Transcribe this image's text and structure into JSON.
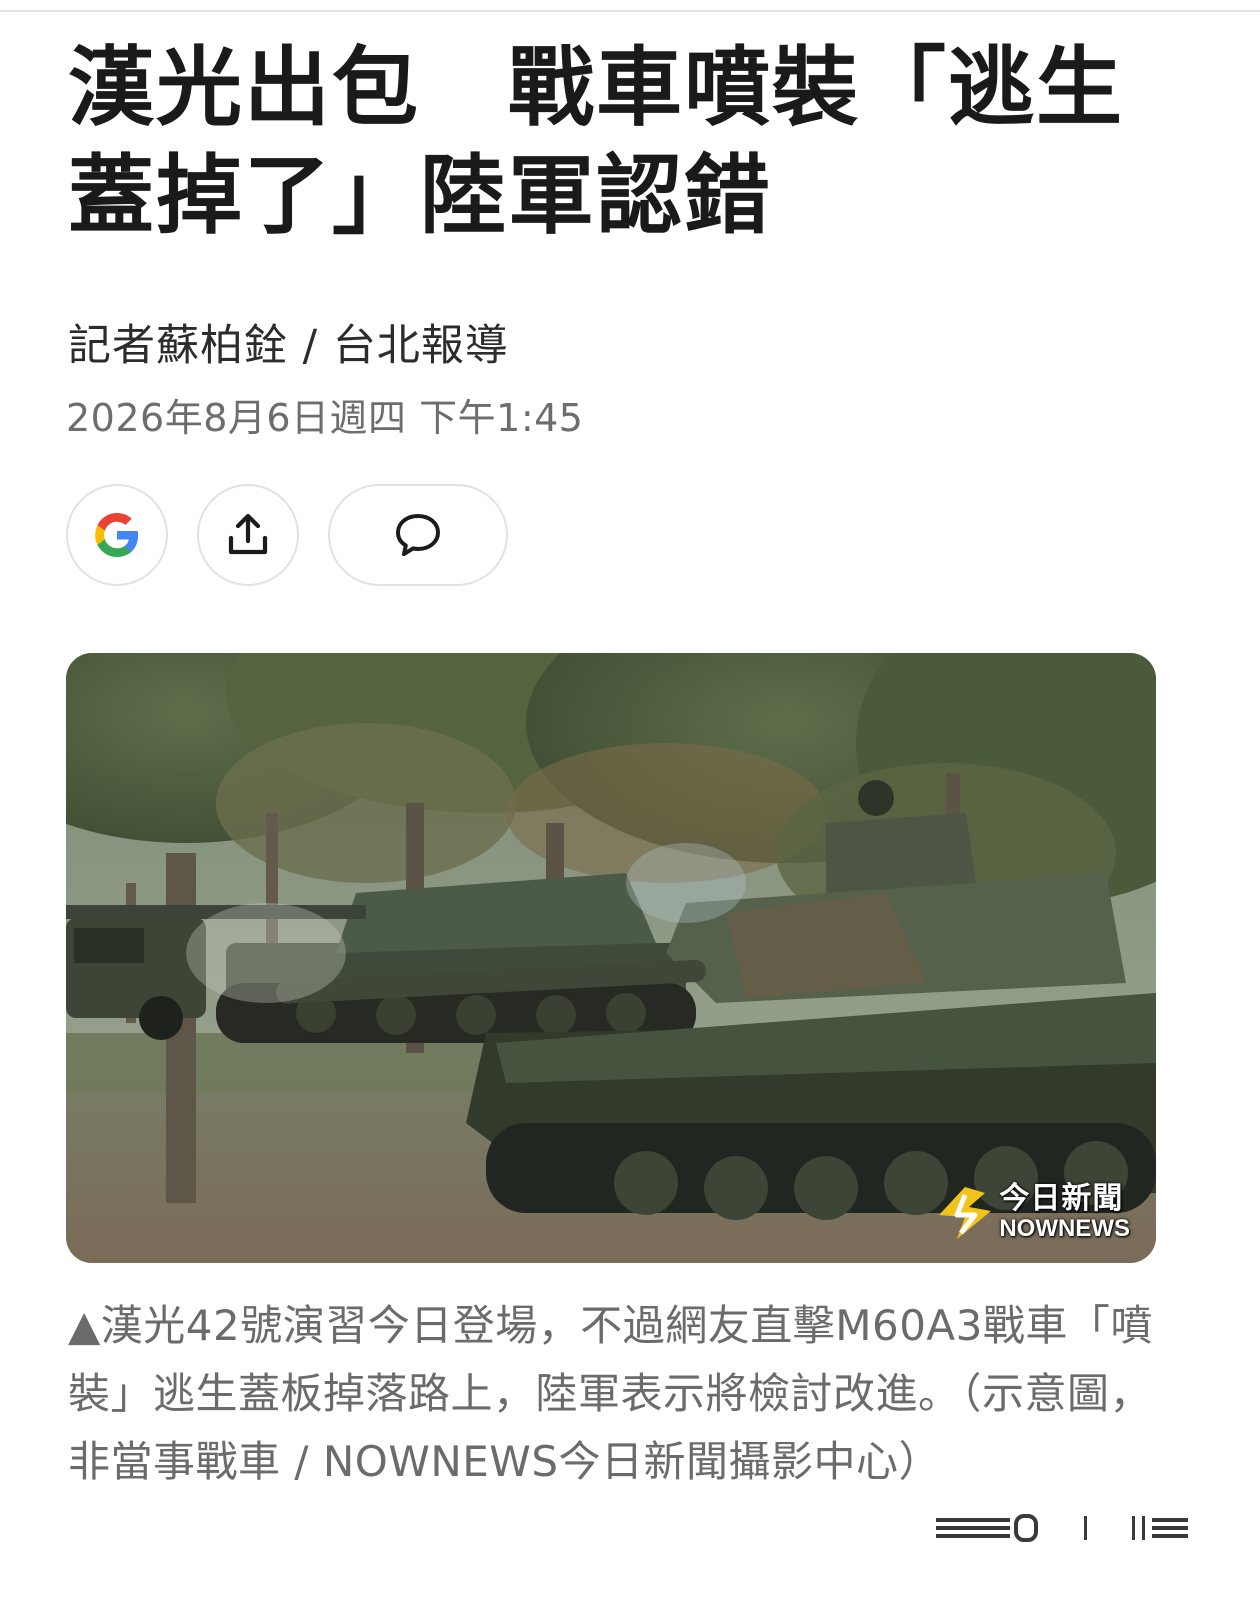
{
  "article": {
    "headline": "漢光出包　戰車噴裝「逃生蓋掉了」陸軍認錯",
    "byline": "記者蘇柏銓 / 台北報導",
    "date": "2026年8月6日週四 下午1:45"
  },
  "actions": {
    "google_icon": "google-g-icon",
    "share_icon": "share-upload-icon",
    "comment_icon": "comment-bubble-icon"
  },
  "photo": {
    "watermark_cn": "今日新聞",
    "watermark_en": "NOWNEWS"
  },
  "caption": {
    "text": "▲漢光42號演習今日登場，不過網友直擊M60A3戰車「噴裝」逃生蓋板掉落路上，陸軍表示將檢討改進。（示意圖，非當事戰車 / NOWNEWS今日新聞攝影中心）"
  },
  "colors": {
    "headline": "#1a1a1a",
    "meta_gray": "#6d6d6d",
    "border": "#e2e2e2",
    "google_blue": "#4285F4",
    "google_red": "#EA4335",
    "google_yellow": "#FBBC05",
    "google_green": "#34A853"
  }
}
